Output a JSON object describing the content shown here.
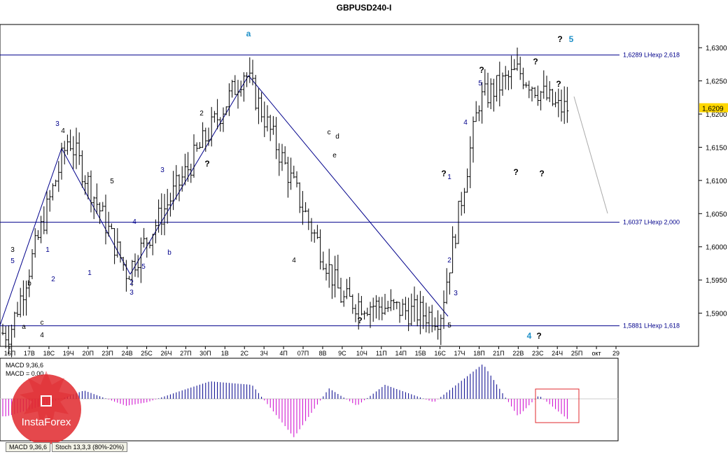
{
  "window_title": "GBPUSD240-I",
  "price_axis": [
    "1,6300",
    "1,6250",
    "1,6200",
    "1,6150",
    "1,6100",
    "1,6050",
    "1,6000",
    "1,5950",
    "1,5900"
  ],
  "current_price": "1,6209",
  "levels": [
    {
      "label": "1,6289 LHexp 2,618",
      "price": 1.6289
    },
    {
      "label": "1,6037 LHexp 2,000",
      "price": 1.6037
    },
    {
      "label": "1,5881 LHexp 1,618",
      "price": 1.5881
    }
  ],
  "time_axis": [
    "16П",
    "17В",
    "18С",
    "19Ч",
    "20П",
    "23П",
    "24В",
    "25С",
    "26Ч",
    "27П",
    "30П",
    "1В",
    "2С",
    "3Ч",
    "4П",
    "07П",
    "8В",
    "9С",
    "10Ч",
    "11П",
    "14П",
    "15В",
    "16С",
    "17Ч",
    "18П",
    "21П",
    "22В",
    "23С",
    "24Ч",
    "25П",
    "окт",
    "29"
  ],
  "macd_label": "MACD 9,36,6",
  "macd_zero_label": "MACD = 0.00",
  "tabs": [
    "MACD 9,36,6",
    "Stoch 13,3,3 (80%-20%)"
  ],
  "logo_text": "InstaForex",
  "colors": {
    "blue": "#00008b",
    "cyan": "#1e90c8",
    "magenta": "#cc00cc",
    "frame_red": "#e0282d",
    "logo_red": "#e0282d"
  },
  "chart_data": {
    "type": "candlestick_ohlc",
    "symbol": "GBPUSD240-I",
    "ylim": [
      1.585,
      1.6335
    ],
    "y_ticks": [
      1.59,
      1.595,
      1.6,
      1.605,
      1.61,
      1.615,
      1.62,
      1.625,
      1.63
    ],
    "key_points": [
      {
        "t": "16П",
        "price": 1.587
      },
      {
        "t": "19Ч",
        "price": 1.6165
      },
      {
        "t": "24В",
        "price": 1.596
      },
      {
        "t": "2С",
        "price": 1.6265
      },
      {
        "t": "9С",
        "price": 1.592
      },
      {
        "t": "16С",
        "price": 1.5895
      },
      {
        "t": "18П",
        "price": 1.622
      },
      {
        "t": "22В",
        "price": 1.6265
      },
      {
        "t": "24Ч",
        "price": 1.6209
      }
    ],
    "wave_labels": [
      "3",
      "5",
      "b",
      "a",
      "c",
      "4",
      "1",
      "2",
      "3",
      "4",
      "5",
      "1",
      "2",
      "3",
      "4",
      "5",
      "3",
      "b",
      "2",
      "?",
      "a",
      "c",
      "e",
      "d",
      "4",
      "?",
      "5",
      "?",
      "1",
      "2",
      "3",
      "4",
      "5",
      "?",
      "?",
      "?",
      "?",
      "?",
      "?",
      "5",
      "4",
      "?"
    ],
    "macd": {
      "name": "MACD 9,36,6",
      "zero": 0.0
    }
  }
}
